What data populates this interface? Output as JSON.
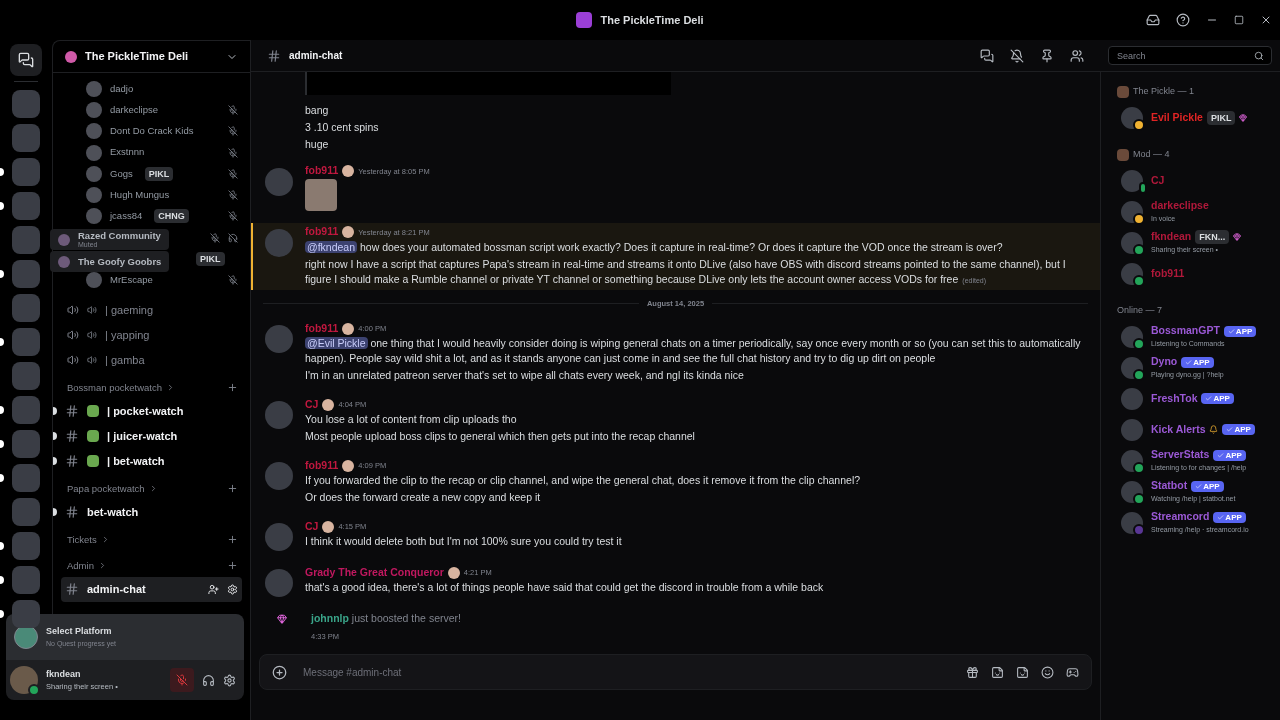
{
  "window": {
    "title": "The PickleTime Deli"
  },
  "servers": [
    {
      "unread": false
    },
    {
      "unread": false
    },
    {
      "unread": true
    },
    {
      "unread": true
    },
    {
      "unread": false
    },
    {
      "unread": true
    },
    {
      "unread": false
    },
    {
      "unread": true
    },
    {
      "unread": false
    },
    {
      "unread": true
    },
    {
      "unread": true
    },
    {
      "unread": true
    },
    {
      "unread": false
    },
    {
      "unread": true
    },
    {
      "unread": true
    },
    {
      "unread": true
    }
  ],
  "tooltips": [
    {
      "title": "Razed Community",
      "subtitle": "Muted"
    },
    {
      "title": "The Goofy Goobrs"
    }
  ],
  "sidebar": {
    "server_name": "The PickleTime Deli",
    "voice_members": [
      {
        "name": "dadjo",
        "muted": false,
        "deafened": false
      },
      {
        "name": "darkeclipse",
        "muted": true,
        "deafened": false
      },
      {
        "name": "Dont Do Crack Kids",
        "muted": true,
        "deafened": false
      },
      {
        "name": "Exstnnn",
        "muted": true,
        "deafened": false
      },
      {
        "name": "Gogs",
        "tag": "PIKL",
        "muted": true,
        "deafened": false
      },
      {
        "name": "Hugh Mungus",
        "muted": true,
        "deafened": false
      },
      {
        "name": "jcass84",
        "tag": "CHNG",
        "muted": true,
        "deafened": false
      },
      {
        "muted": true,
        "deafened": true
      },
      {
        "tag": "PIKL",
        "muted": false,
        "deafened": false
      },
      {
        "name": "MrEscape",
        "muted": true,
        "deafened": false
      }
    ],
    "voice_channels": [
      {
        "name": "| gaeming"
      },
      {
        "name": "| yapping"
      },
      {
        "name": "| gamba"
      }
    ],
    "categories": [
      {
        "name": "Bossman pocketwatch",
        "channels": [
          {
            "name": "| pocket-watch",
            "emoji": true,
            "unread": true,
            "selected": false
          },
          {
            "name": "| juicer-watch",
            "emoji": true,
            "unread": true,
            "selected": false
          },
          {
            "name": "| bet-watch",
            "emoji": true,
            "unread": true,
            "selected": false
          }
        ]
      },
      {
        "name": "Papa pocketwatch",
        "channels": [
          {
            "name": "bet-watch",
            "emoji": false,
            "unread": true,
            "selected": false
          }
        ]
      },
      {
        "name": "Tickets"
      },
      {
        "name": "Admin",
        "channels": [
          {
            "name": "admin-chat",
            "emoji": false,
            "unread": false,
            "selected": true
          }
        ]
      }
    ],
    "quest": {
      "title": "Select Platform",
      "subtitle": "No Quest progress yet"
    },
    "user": {
      "name": "fkndean",
      "status": "Sharing their screen •",
      "muted": true
    }
  },
  "channel": {
    "name": "admin-chat"
  },
  "search": {
    "placeholder": "Search"
  },
  "messages": [
    {
      "kind": "continuation",
      "lines": [
        {
          "text": "bang"
        },
        {
          "text": "3 .10 cent spins"
        },
        {
          "text": "huge"
        }
      ]
    },
    {
      "kind": "message",
      "author": "fob911",
      "color": "#c0183f",
      "time": "Yesterday at 8:05 PM",
      "highlighted": false,
      "image": true
    },
    {
      "kind": "message",
      "author": "fob911",
      "color": "#c0183f",
      "time": "Yesterday at 8:21 PM",
      "highlighted": true,
      "image": false,
      "lines": [
        {
          "mention": "@fkndean",
          "text": "how does your automated bossman script work exactly? Does it capture in real-time? Or does it capture the VOD once the stream is over?"
        },
        {
          "text": "right now I have a script that captures Papa's stream in real-time and streams it onto DLive (also have OBS with discord streams pointed to the same channel), but I figure I should make a Rumble channel or private YT channel or something because DLive only lets the account owner access VODs for free",
          "edited": "(edited)"
        }
      ]
    },
    {
      "kind": "divider",
      "text": "August 14, 2025"
    },
    {
      "kind": "message",
      "author": "fob911",
      "color": "#c0183f",
      "time": "4:00 PM",
      "highlighted": false,
      "image": false,
      "lines": [
        {
          "mention": "@Evil Pickle",
          "text": "one thing that I would heavily consider doing is wiping general chats on a timer periodically, say once every month or so (you can set this to automatically happen). People say wild shit a lot, and as it stands anyone can just come in and see the full chat history and try to dig up dirt on people"
        },
        {
          "text": "I'm in an unrelated patreon server that's set to wipe all chats every week, and ngl its kinda nice"
        }
      ]
    },
    {
      "kind": "message",
      "author": "CJ",
      "color": "#c0183f",
      "time": "4:04 PM",
      "highlighted": false,
      "image": false,
      "lines": [
        {
          "text": "You lose a lot of content from clip uploads tho"
        },
        {
          "text": "Most people upload boss clips to general which then gets put into the recap channel"
        }
      ]
    },
    {
      "kind": "message",
      "author": "fob911",
      "color": "#c0183f",
      "time": "4:09 PM",
      "highlighted": false,
      "image": false,
      "lines": [
        {
          "text": "If you forwarded the clip to the recap or clip channel, and wipe the general chat, does it remove it from the clip channel?"
        },
        {
          "text": "Or does the forward create a new copy and keep it"
        }
      ]
    },
    {
      "kind": "message",
      "author": "CJ",
      "color": "#c0183f",
      "time": "4:15 PM",
      "highlighted": false,
      "image": false,
      "lines": [
        {
          "text": "I think it would delete both but I'm not 100% sure you could try test it"
        }
      ]
    },
    {
      "kind": "message",
      "author": "Grady The Great Conqueror",
      "color": "#c0185f",
      "time": "4:21 PM",
      "highlighted": false,
      "image": false,
      "lines": [
        {
          "text": "that's a good idea, there's a lot of things people have said that could get the discord in trouble from a while back"
        }
      ]
    },
    {
      "kind": "system",
      "author": "johnnlp",
      "color": "#3aa58a",
      "text": "just boosted the server!",
      "time": "4:33 PM"
    }
  ],
  "composer": {
    "placeholder": "Message #admin-chat"
  },
  "members": [
    {
      "title": "The Pickle — 1",
      "items": [
        {
          "name": "Evil Pickle",
          "color": "#e02424",
          "tag": "PIKL",
          "boosting": true,
          "kind": "idle"
        }
      ]
    },
    {
      "title": "Mod — 4",
      "items": [
        {
          "name": "CJ",
          "color": "#b0183a",
          "kind": "mobile"
        },
        {
          "name": "darkeclipse",
          "color": "#b0183a",
          "status": "In voice",
          "kind": "idle"
        },
        {
          "name": "fkndean",
          "color": "#b0183a",
          "tag": "FKN...",
          "boosting": true,
          "status": "Sharing their screen •",
          "kind": "online"
        },
        {
          "name": "fob911",
          "color": "#b0183a",
          "kind": "online"
        }
      ]
    },
    {
      "title": "Online — 7",
      "items": [
        {
          "name": "BossmanGPT",
          "color": "#9b59d6",
          "badge": "APP",
          "status": "Listening to Commands",
          "kind": "online"
        },
        {
          "name": "Dyno",
          "color": "#9b59d6",
          "badge": "APP",
          "status": "Playing dyno.gg | ?help",
          "kind": "online"
        },
        {
          "name": "FreshTok",
          "color": "#9b59d6",
          "badge": "APP",
          "kind": "offline"
        },
        {
          "name": "Kick Alerts",
          "color": "#9b59d6",
          "badge": "APP",
          "bell": true,
          "kind": "offline"
        },
        {
          "name": "ServerStats",
          "color": "#9b59d6",
          "badge": "APP",
          "status": "Listening to for changes | /help",
          "kind": "online"
        },
        {
          "name": "Statbot",
          "color": "#9b59d6",
          "badge": "APP",
          "status": "Watching /help | statbot.net",
          "kind": "online"
        },
        {
          "name": "Streamcord",
          "color": "#9b59d6",
          "badge": "APP",
          "status": "Streaming /help · streamcord.io",
          "kind": "streaming"
        }
      ]
    }
  ]
}
